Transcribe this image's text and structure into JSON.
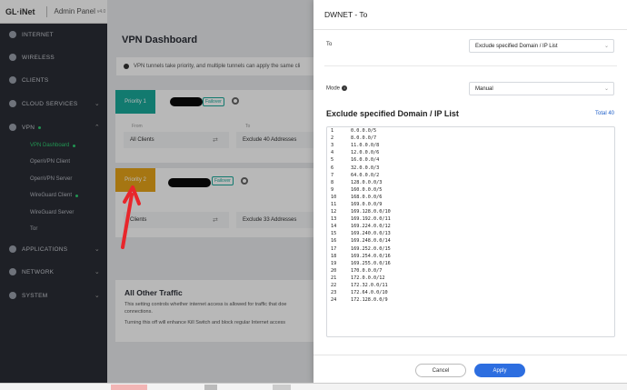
{
  "sidebar": {
    "logo": "GL·iNet",
    "title": "Admin Panel",
    "version": "v4.0",
    "items": [
      {
        "label": "INTERNET",
        "icon": "globe-icon"
      },
      {
        "label": "WIRELESS",
        "icon": "wifi-icon"
      },
      {
        "label": "CLIENTS",
        "icon": "clients-icon"
      },
      {
        "label": "CLOUD SERVICES",
        "icon": "cloud-icon"
      },
      {
        "label": "VPN",
        "icon": "vpn-icon"
      },
      {
        "label": "APPLICATIONS",
        "icon": "apps-icon"
      },
      {
        "label": "NETWORK",
        "icon": "network-icon"
      },
      {
        "label": "SYSTEM",
        "icon": "system-icon"
      }
    ],
    "vpn_sub": [
      {
        "label": "VPN Dashboard"
      },
      {
        "label": "OpenVPN Client"
      },
      {
        "label": "OpenVPN Server"
      },
      {
        "label": "WireGuard Client"
      },
      {
        "label": "WireGuard Server"
      },
      {
        "label": "Tor"
      }
    ]
  },
  "main": {
    "title": "VPN Dashboard",
    "info": "VPN tunnels take priority, and multiple tunnels can apply the same cli",
    "priority1": {
      "label": "Priority 1",
      "badge": "Failover",
      "from_label": "From",
      "to_label": "To",
      "from_value": "All Clients",
      "to_value": "Exclude 40 Addresses"
    },
    "priority2": {
      "label": "Priority 2",
      "badge": "Failover",
      "from_value": "Clients",
      "to_value": "Exclude 33 Addresses"
    },
    "other": {
      "title": "All Other Traffic",
      "text1": "This setting controls whether internet access is allowed for traffic that doe",
      "text1b": "connections.",
      "text2": "Turning this off will enhance Kill Switch and block regular Internet access"
    }
  },
  "drawer": {
    "title": "DWNET - To",
    "to_label": "To",
    "to_value": "Exclude specified Domain / IP List",
    "mode_label": "Mode",
    "mode_value": "Manual",
    "section_title": "Exclude specified Domain / IP List",
    "total": "Total 40",
    "list": [
      "0.0.0.0/5",
      "8.0.0.0/7",
      "11.0.0.0/8",
      "12.0.0.0/6",
      "16.0.0.0/4",
      "32.0.0.0/3",
      "64.0.0.0/2",
      "128.0.0.0/3",
      "160.0.0.0/5",
      "168.0.0.0/6",
      "169.0.0.0/9",
      "169.128.0.0/10",
      "169.192.0.0/11",
      "169.224.0.0/12",
      "169.240.0.0/13",
      "169.248.0.0/14",
      "169.252.0.0/15",
      "169.254.0.0/16",
      "169.255.0.0/16",
      "170.0.0.0/7",
      "172.0.0.0/12",
      "172.32.0.0/11",
      "172.64.0.0/10",
      "172.128.0.0/9"
    ],
    "cancel": "Cancel",
    "apply": "Apply"
  },
  "colors": {
    "accent": "#2d6ee0",
    "priority1": "#19a99a",
    "priority2": "#e7a41a",
    "arrow": "#e8262b"
  }
}
